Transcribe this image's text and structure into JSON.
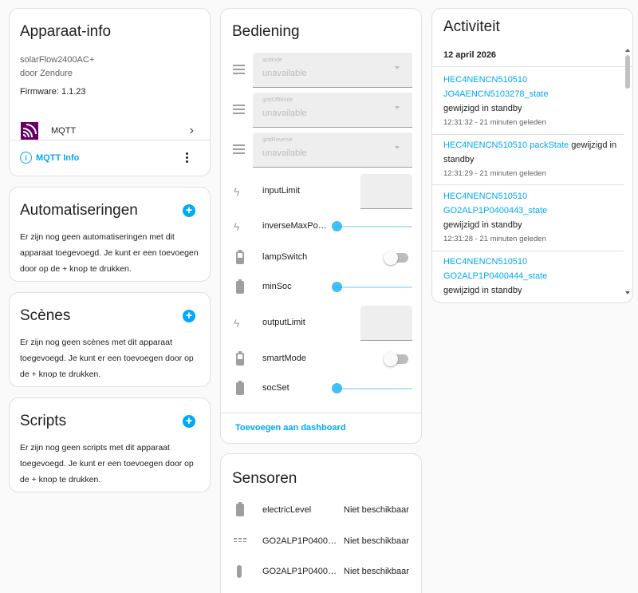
{
  "device": {
    "title": "Apparaat-info",
    "model": "solarFlow2400AC+",
    "manufacturer": "door Zendure",
    "firmware": "Firmware: 1.1.23",
    "integration": "MQTT",
    "info_button": "MQTT Info"
  },
  "automations": {
    "title": "Automatiseringen",
    "text": "Er zijn nog geen automatiseringen met dit apparaat toegevoegd. Je kunt er een toevoegen door op de + knop te drukken."
  },
  "scenes": {
    "title": "Scènes",
    "text": "Er zijn nog geen scènes met dit apparaat toegevoegd. Je kunt er een toevoegen door op de + knop te drukken."
  },
  "scripts": {
    "title": "Scripts",
    "text": "Er zijn nog geen scripts met dit apparaat toegevoegd. Je kunt er een toevoegen door op de + knop te drukken."
  },
  "controls": {
    "title": "Bediening",
    "selects": [
      {
        "label": "acMode",
        "value": "unavailable"
      },
      {
        "label": "gridOffMode",
        "value": "unavailable"
      },
      {
        "label": "gridReverse",
        "value": "unavailable"
      }
    ],
    "entities": {
      "inputLimit": "inputLimit",
      "inverseMaxPower": "inverseMaxPo…",
      "lampSwitch": "lampSwitch",
      "minSoc": "minSoc",
      "outputLimit": "outputLimit",
      "smartMode": "smartMode",
      "socSet": "socSet"
    },
    "add_to_dashboard": "Toevoegen aan dashboard"
  },
  "sensors": {
    "title": "Sensoren",
    "rows": [
      {
        "name": "electricLevel",
        "value": "Niet beschikbaar",
        "icon": "battery-icon"
      },
      {
        "name": "GO2ALP1P04004…",
        "value": "Niet beschikbaar",
        "icon": "sine-wave-icon"
      },
      {
        "name": "GO2ALP1P04004…",
        "value": "Niet beschikbaar",
        "icon": "thermometer-icon"
      }
    ]
  },
  "activity": {
    "title": "Activiteit",
    "date": "12 april 2026",
    "events": [
      {
        "entity": "HEC4NENCN510510 JO4AENCN5103278_state",
        "action": "gewijzigd in standby",
        "time": "12:31:32 - 21 minuten geleden"
      },
      {
        "entity": "HEC4NENCN510510 packState",
        "action": "gewijzigd in standby",
        "time": "12:31:29 - 21 minuten geleden"
      },
      {
        "entity": "HEC4NENCN510510 GO2ALP1P0400443_state",
        "action": "gewijzigd in standby",
        "time": "12:31:28 - 21 minuten geleden"
      },
      {
        "entity": "HEC4NENCN510510 GO2ALP1P0400444_state",
        "action": "gewijzigd in standby",
        "time": ""
      }
    ]
  },
  "colors": {
    "accent": "#03a9f4",
    "mqtt_logo": "#660066"
  }
}
